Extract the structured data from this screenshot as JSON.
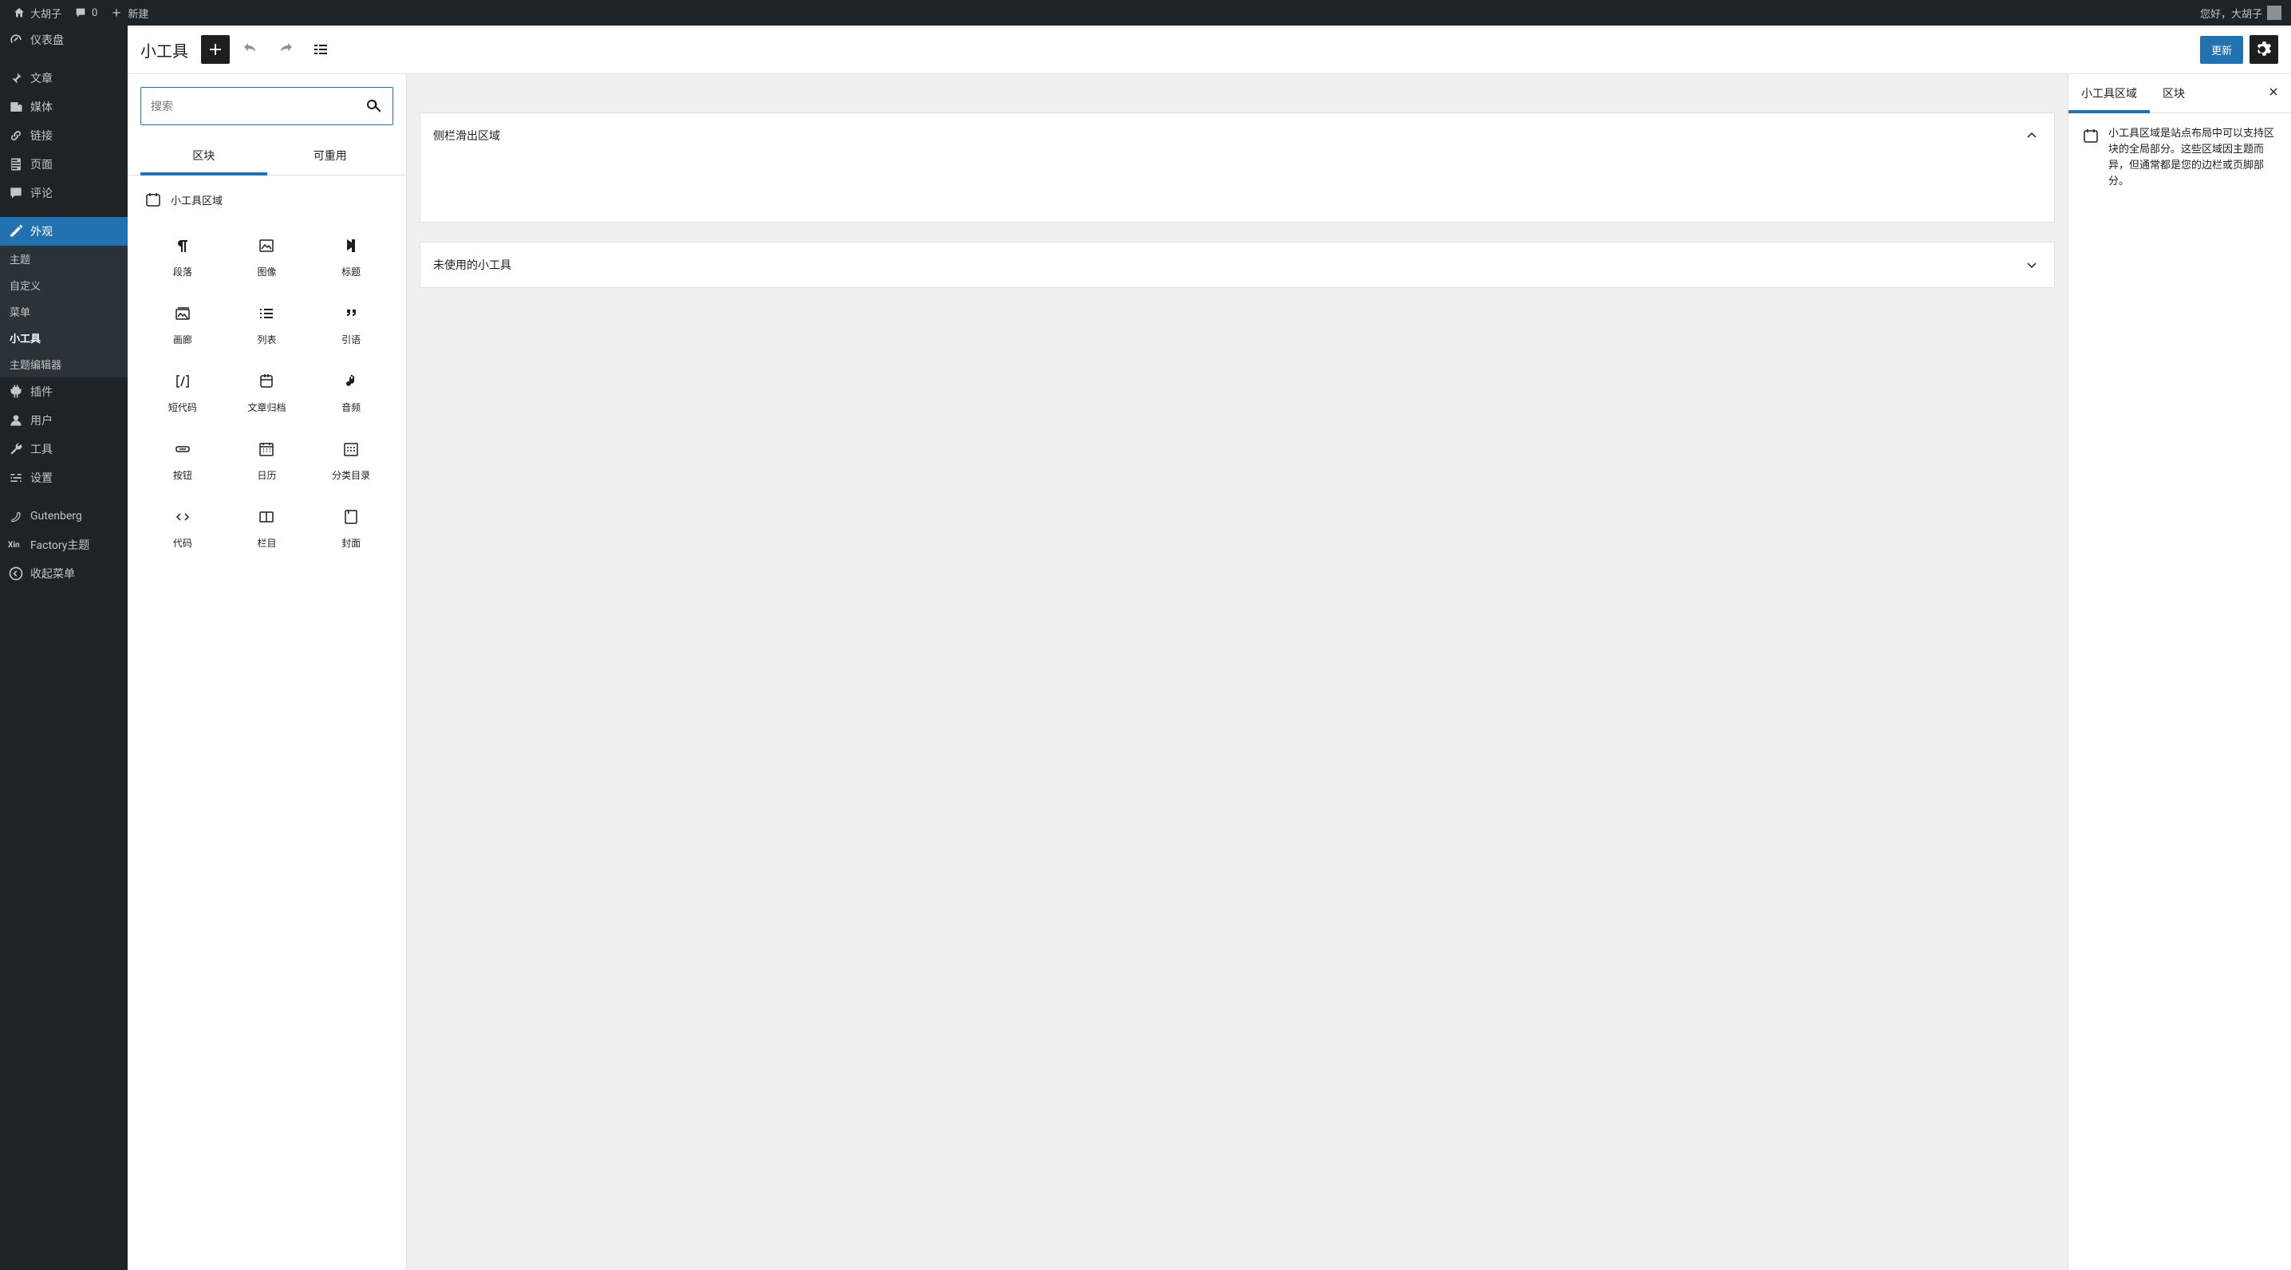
{
  "admin_bar": {
    "site_name": "大胡子",
    "comments_count": "0",
    "new_label": "新建",
    "greeting": "您好，大胡子"
  },
  "sidebar": {
    "items": [
      {
        "label": "仪表盘",
        "icon": "dashboard"
      },
      {
        "label": "文章",
        "icon": "pin"
      },
      {
        "label": "媒体",
        "icon": "media"
      },
      {
        "label": "链接",
        "icon": "link"
      },
      {
        "label": "页面",
        "icon": "page"
      },
      {
        "label": "评论",
        "icon": "comment"
      },
      {
        "label": "外观",
        "icon": "appearance",
        "active": true
      },
      {
        "label": "插件",
        "icon": "plugin"
      },
      {
        "label": "用户",
        "icon": "user"
      },
      {
        "label": "工具",
        "icon": "tool"
      },
      {
        "label": "设置",
        "icon": "settings"
      },
      {
        "label": "Gutenberg",
        "icon": "gutenberg"
      },
      {
        "label": "Factory主题",
        "icon": "xin"
      },
      {
        "label": "收起菜单",
        "icon": "collapse"
      }
    ],
    "submenu": [
      {
        "label": "主题"
      },
      {
        "label": "自定义"
      },
      {
        "label": "菜单"
      },
      {
        "label": "小工具",
        "active": true
      },
      {
        "label": "主题编辑器"
      }
    ]
  },
  "editor": {
    "title": "小工具",
    "update_button": "更新"
  },
  "inserter": {
    "search_placeholder": "搜索",
    "tabs": {
      "blocks": "区块",
      "reusable": "可重用"
    },
    "category_label": "小工具区域",
    "blocks": [
      {
        "label": "段落",
        "icon": "paragraph"
      },
      {
        "label": "图像",
        "icon": "image"
      },
      {
        "label": "标题",
        "icon": "heading"
      },
      {
        "label": "画廊",
        "icon": "gallery"
      },
      {
        "label": "列表",
        "icon": "list"
      },
      {
        "label": "引语",
        "icon": "quote"
      },
      {
        "label": "短代码",
        "icon": "shortcode"
      },
      {
        "label": "文章归档",
        "icon": "archive"
      },
      {
        "label": "音频",
        "icon": "audio"
      },
      {
        "label": "按钮",
        "icon": "button"
      },
      {
        "label": "日历",
        "icon": "calendar"
      },
      {
        "label": "分类目录",
        "icon": "categories"
      },
      {
        "label": "代码",
        "icon": "code"
      },
      {
        "label": "栏目",
        "icon": "columns"
      },
      {
        "label": "封面",
        "icon": "cover"
      }
    ]
  },
  "canvas": {
    "areas": [
      {
        "title": "侧栏滑出区域",
        "expanded": true
      },
      {
        "title": "未使用的小工具",
        "expanded": false
      }
    ]
  },
  "settings": {
    "tabs": {
      "widget_area": "小工具区域",
      "block": "区块"
    },
    "description": "小工具区域是站点布局中可以支持区块的全局部分。这些区域因主题而异，但通常都是您的边栏或页脚部分。"
  }
}
